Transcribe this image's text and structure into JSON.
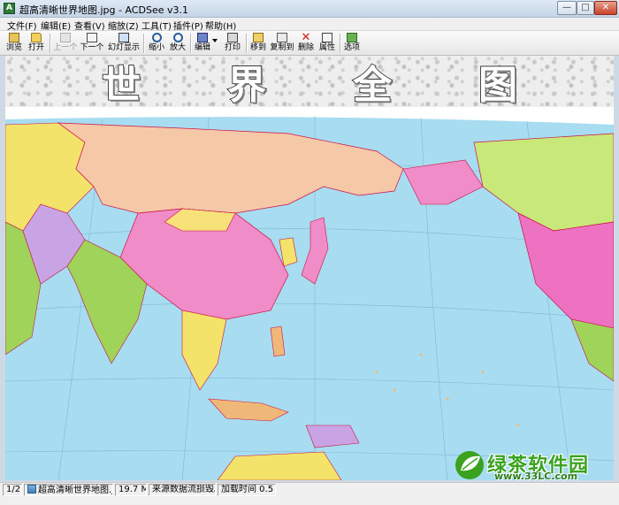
{
  "window": {
    "title": "超高清晰世界地图.jpg - ACDSee v3.1",
    "app_icon_letter": "A"
  },
  "menu": [
    "文件(F)",
    "编辑(E)",
    "查看(V)",
    "缩放(Z)",
    "工具(T)",
    "插件(P)",
    "帮助(H)"
  ],
  "toolbar": {
    "browse": "浏览",
    "open": "打开",
    "prev": "上一个",
    "next": "下一个",
    "slideshow": "幻灯显示",
    "zoom_out": "缩小",
    "zoom_in": "放大",
    "edit": "编辑",
    "print": "打印",
    "move_to": "移到",
    "copy_to": "复制到",
    "delete": "删除",
    "properties": "属性",
    "options": "选项"
  },
  "image": {
    "banner_chars": [
      "世",
      "界",
      "全",
      "图"
    ]
  },
  "watermark": {
    "name": "绿茶软件园",
    "url": "www.33LC.com"
  },
  "status": {
    "index": "1/2",
    "filename": "超高清晰世界地图.jpg",
    "size": "19.7 MB",
    "message": "来源数据流损毁。",
    "load_time": "加载时间 0.5 秒"
  },
  "colors": {
    "ocean": "#a8dcf0",
    "russia": "#f5c8a8",
    "china": "#f08cc8",
    "canada": "#c8e87a",
    "usa": "#ee72c2",
    "watermark_green": "#3aa21f"
  }
}
